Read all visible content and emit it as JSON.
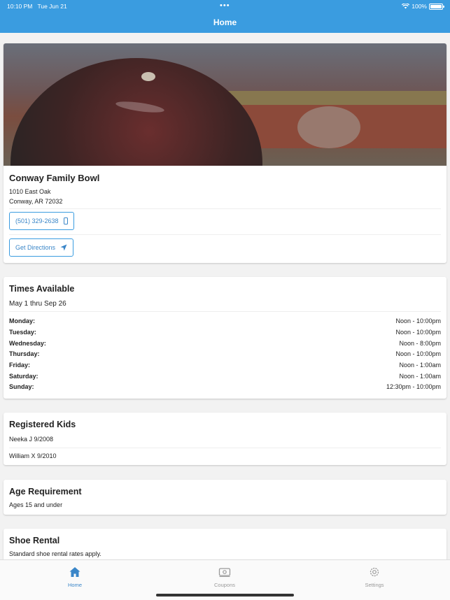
{
  "status_bar": {
    "time": "10:10 PM",
    "date": "Tue Jun 21",
    "battery": "100%"
  },
  "nav": {
    "title": "Home"
  },
  "venue": {
    "name": "Conway Family Bowl",
    "address_line1": "1010 East Oak",
    "address_line2": "Conway, AR 72032",
    "phone": "(501) 329-2638",
    "directions_label": "Get Directions"
  },
  "times": {
    "title": "Times Available",
    "date_range": "May 1 thru Sep 26",
    "rows": [
      {
        "day": "Monday:",
        "hours": "Noon - 10:00pm"
      },
      {
        "day": "Tuesday:",
        "hours": "Noon - 10:00pm"
      },
      {
        "day": "Wednesday:",
        "hours": "Noon - 8:00pm"
      },
      {
        "day": "Thursday:",
        "hours": "Noon - 10:00pm"
      },
      {
        "day": "Friday:",
        "hours": "Noon - 1:00am"
      },
      {
        "day": "Saturday:",
        "hours": "Noon - 1:00am"
      },
      {
        "day": "Sunday:",
        "hours": "12:30pm - 10:00pm"
      }
    ]
  },
  "kids": {
    "title": "Registered Kids",
    "items": [
      "Neeka J 9/2008",
      "William X 9/2010"
    ]
  },
  "age": {
    "title": "Age Requirement",
    "text": "Ages 15 and under"
  },
  "shoes": {
    "title": "Shoe Rental",
    "text": "Standard shoe rental rates apply."
  },
  "tabs": [
    {
      "label": "Home",
      "icon": "house-icon",
      "active": true
    },
    {
      "label": "Coupons",
      "icon": "ticket-icon",
      "active": false
    },
    {
      "label": "Settings",
      "icon": "gear-icon",
      "active": false
    }
  ],
  "colors": {
    "accent": "#3a9ce0",
    "link": "#3a86c8"
  }
}
